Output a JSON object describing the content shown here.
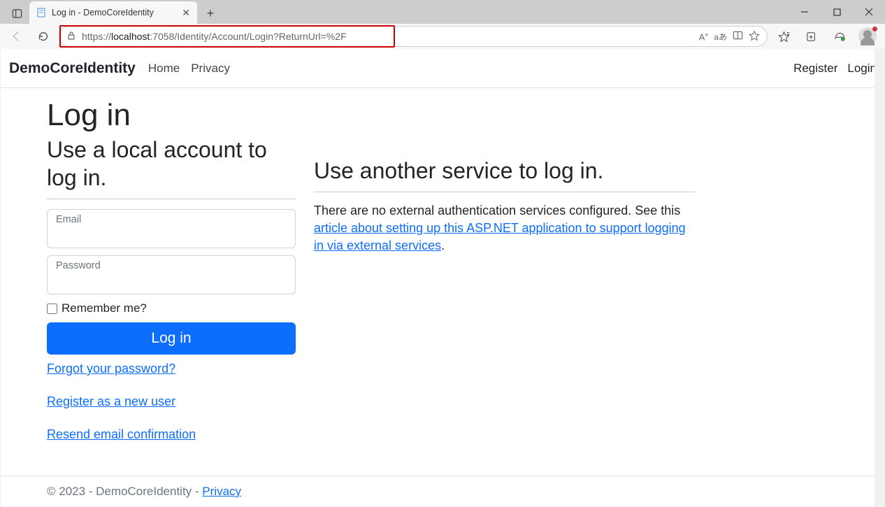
{
  "browser": {
    "tab_title": "Log in - DemoCoreIdentity",
    "url_prefix": "https://",
    "url_host": "localhost",
    "url_rest": ":7058/Identity/Account/Login?ReturnUrl=%2F"
  },
  "nav": {
    "brand": "DemoCoreIdentity",
    "home": "Home",
    "privacy": "Privacy",
    "register": "Register",
    "login": "Login"
  },
  "page": {
    "title": "Log in",
    "local_heading": "Use a local account to log in.",
    "email_label": "Email",
    "password_label": "Password",
    "remember_label": "Remember me?",
    "login_button": "Log in",
    "forgot_link": "Forgot your password?",
    "register_link": "Register as a new user",
    "resend_link": "Resend email confirmation",
    "external_heading": "Use another service to log in.",
    "external_text_pre": "There are no external authentication services configured. See this ",
    "external_link": "article about setting up this ASP.NET application to support logging in via external services",
    "external_text_post": "."
  },
  "footer": {
    "text": "© 2023 - DemoCoreIdentity - ",
    "privacy": "Privacy"
  }
}
